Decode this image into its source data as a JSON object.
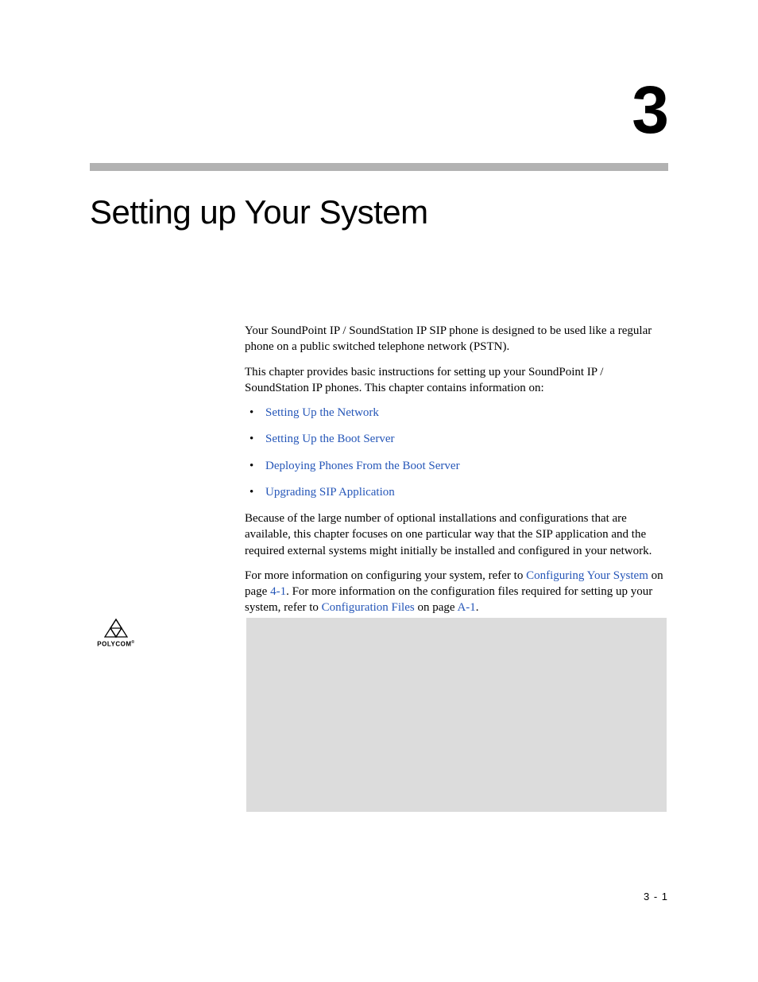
{
  "chapter": {
    "number": "3",
    "title": "Setting up Your System"
  },
  "paragraphs": {
    "intro1": "Your SoundPoint IP / SoundStation IP SIP phone is designed to be used like a regular phone on a public switched telephone network (PSTN).",
    "intro2": "This chapter provides basic instructions for setting up your SoundPoint IP / SoundStation IP phones. This chapter contains information on:",
    "after_bullets": "Because of the large number of optional installations and configurations that are available, this chapter focuses on one particular way that the SIP application and the required external systems might initially be installed and configured in your network.",
    "more_info_prefix": "For more information on configuring your system, refer to ",
    "more_info_link1": "Configuring Your System",
    "more_info_mid1": " on page ",
    "more_info_pageref1": "4-1",
    "more_info_mid2": ". For more information on the configuration files required for setting up your system, refer to ",
    "more_info_link2": "Configuration Files",
    "more_info_mid3": " on page ",
    "more_info_pageref2": "A-1",
    "more_info_suffix": "."
  },
  "bullets": [
    "Setting Up the Network",
    "Setting Up the Boot Server",
    "Deploying Phones From the Boot Server",
    "Upgrading SIP Application"
  ],
  "logo": {
    "text": "POLYCOM"
  },
  "page_number": "3 - 1"
}
